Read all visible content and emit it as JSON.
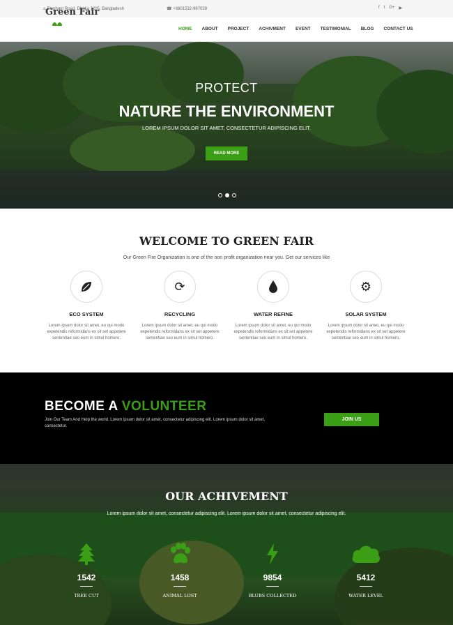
{
  "topbar": {
    "address": "Elephant Road, Dhaka 1205, Bangladesh",
    "phone": "+8801532-987039",
    "socials": [
      {
        "icon": "facebook-icon",
        "glyph": "f"
      },
      {
        "icon": "twitter-icon",
        "glyph": "t"
      },
      {
        "icon": "google-plus-icon",
        "glyph": "G+"
      },
      {
        "icon": "youtube-icon",
        "glyph": "▶"
      }
    ]
  },
  "nav": {
    "logo": "Green Fair",
    "items": [
      "HOME",
      "ABOUT",
      "PROJECT",
      "ACHIVMENT",
      "EVENT",
      "TESTIMONIAL",
      "BLOG",
      "CONTACT US"
    ],
    "active": "HOME"
  },
  "hero": {
    "line1": "PROTECT",
    "line2": "NATURE THE ENVIRONMENT",
    "line3": "LOREM IPSUM DOLOR SIT AMET, CONSECTETUR ADIPISCING ELIT.",
    "button": "READ MORE",
    "active_slide": 2,
    "slides": 3
  },
  "welcome": {
    "title": "WELCOME TO GREEN FAIR",
    "subtitle": "Our Green Fire Organization is one of the non profit organization near you. Get our services like",
    "services": [
      {
        "name": "ECO SYSTEM",
        "icon": "leaf-icon",
        "desc": "Lorem ipsum dolor sit amet, eu qui modo expetendis reformidans ex sit set appetere sententiae seo eum in simul homero."
      },
      {
        "name": "RECYCLING",
        "icon": "recycle-icon",
        "desc": "Lorem ipsum dolor sit amet, eu qui modo expetendis reformidans ex sit set appetere sententiae seo eum in simul homero."
      },
      {
        "name": "WATER REFINE",
        "icon": "water-drop-icon",
        "desc": "Lorem ipsum dolor sit amet, eu qui modo expetendis reformidans ex sit set appetere sententiae seo eum in simul homero."
      },
      {
        "name": "SOLAR SYSTEM",
        "icon": "gear-icon",
        "desc": "Lorem ipsum dolor sit amet, eu qui modo expetendis reformidans ex sit set appetere sententiae seo eum in simul homero."
      }
    ]
  },
  "volunteer": {
    "title_a": "BECOME A",
    "title_b": "VOLUNTEER",
    "text": "Join Our Team And Help the world. Lorem ipsum dolor sit amet, consectetur adipiscing elit. Lorem ipsum dolor sit amet, consectetur.",
    "button": "JOIN US"
  },
  "achievement": {
    "title": "OUR ACHIVEMENT",
    "subtitle": "Lorem ipsum dolor sit amet, consectetur adipiscing elit. Lorem ipsum dolor sit amet, consectetur adipiscing elit.",
    "stats": [
      {
        "value": "1542",
        "label": "TREE CUT",
        "icon": "tree-icon"
      },
      {
        "value": "1458",
        "label": "ANIMAL LOST",
        "icon": "paw-icon"
      },
      {
        "value": "9854",
        "label": "BLUBS COLLECTED",
        "icon": "lightning-icon"
      },
      {
        "value": "5412",
        "label": "WATER LEVEL",
        "icon": "cloud-icon"
      }
    ]
  },
  "colors": {
    "accent": "#3a9f14",
    "dark": "#000000"
  }
}
